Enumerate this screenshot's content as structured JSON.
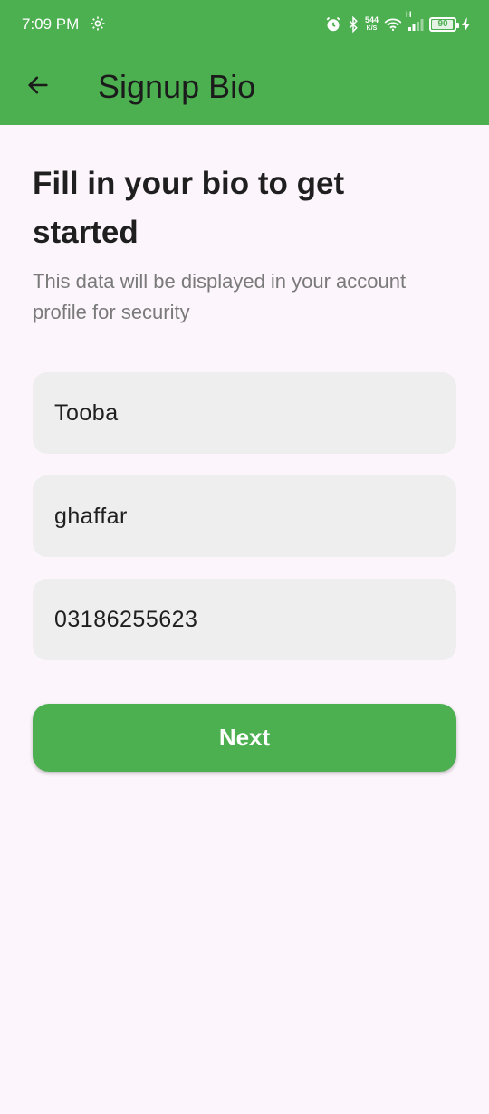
{
  "status_bar": {
    "time": "7:09 PM",
    "net_speed_value": "544",
    "net_speed_unit": "K/S",
    "network_type": "H",
    "battery_level": "90",
    "icons": [
      "gear-icon",
      "alarm-icon",
      "bluetooth-icon",
      "wifi-icon",
      "signal-icon",
      "battery-icon",
      "charging-icon"
    ]
  },
  "app_bar": {
    "title": "Signup Bio",
    "back_icon": "arrow-left-icon"
  },
  "content": {
    "heading": "Fill in your bio to get started",
    "subheading": "This data will be displayed in your account profile for security"
  },
  "form": {
    "first_name": {
      "value": "Tooba"
    },
    "last_name": {
      "value": "ghaffar"
    },
    "phone": {
      "value": "03186255623"
    }
  },
  "actions": {
    "next_label": "Next"
  },
  "colors": {
    "accent": "#4caf50",
    "background": "#fcf6fc",
    "field_background": "#eeeeee",
    "subtext": "#7a7a7a"
  }
}
